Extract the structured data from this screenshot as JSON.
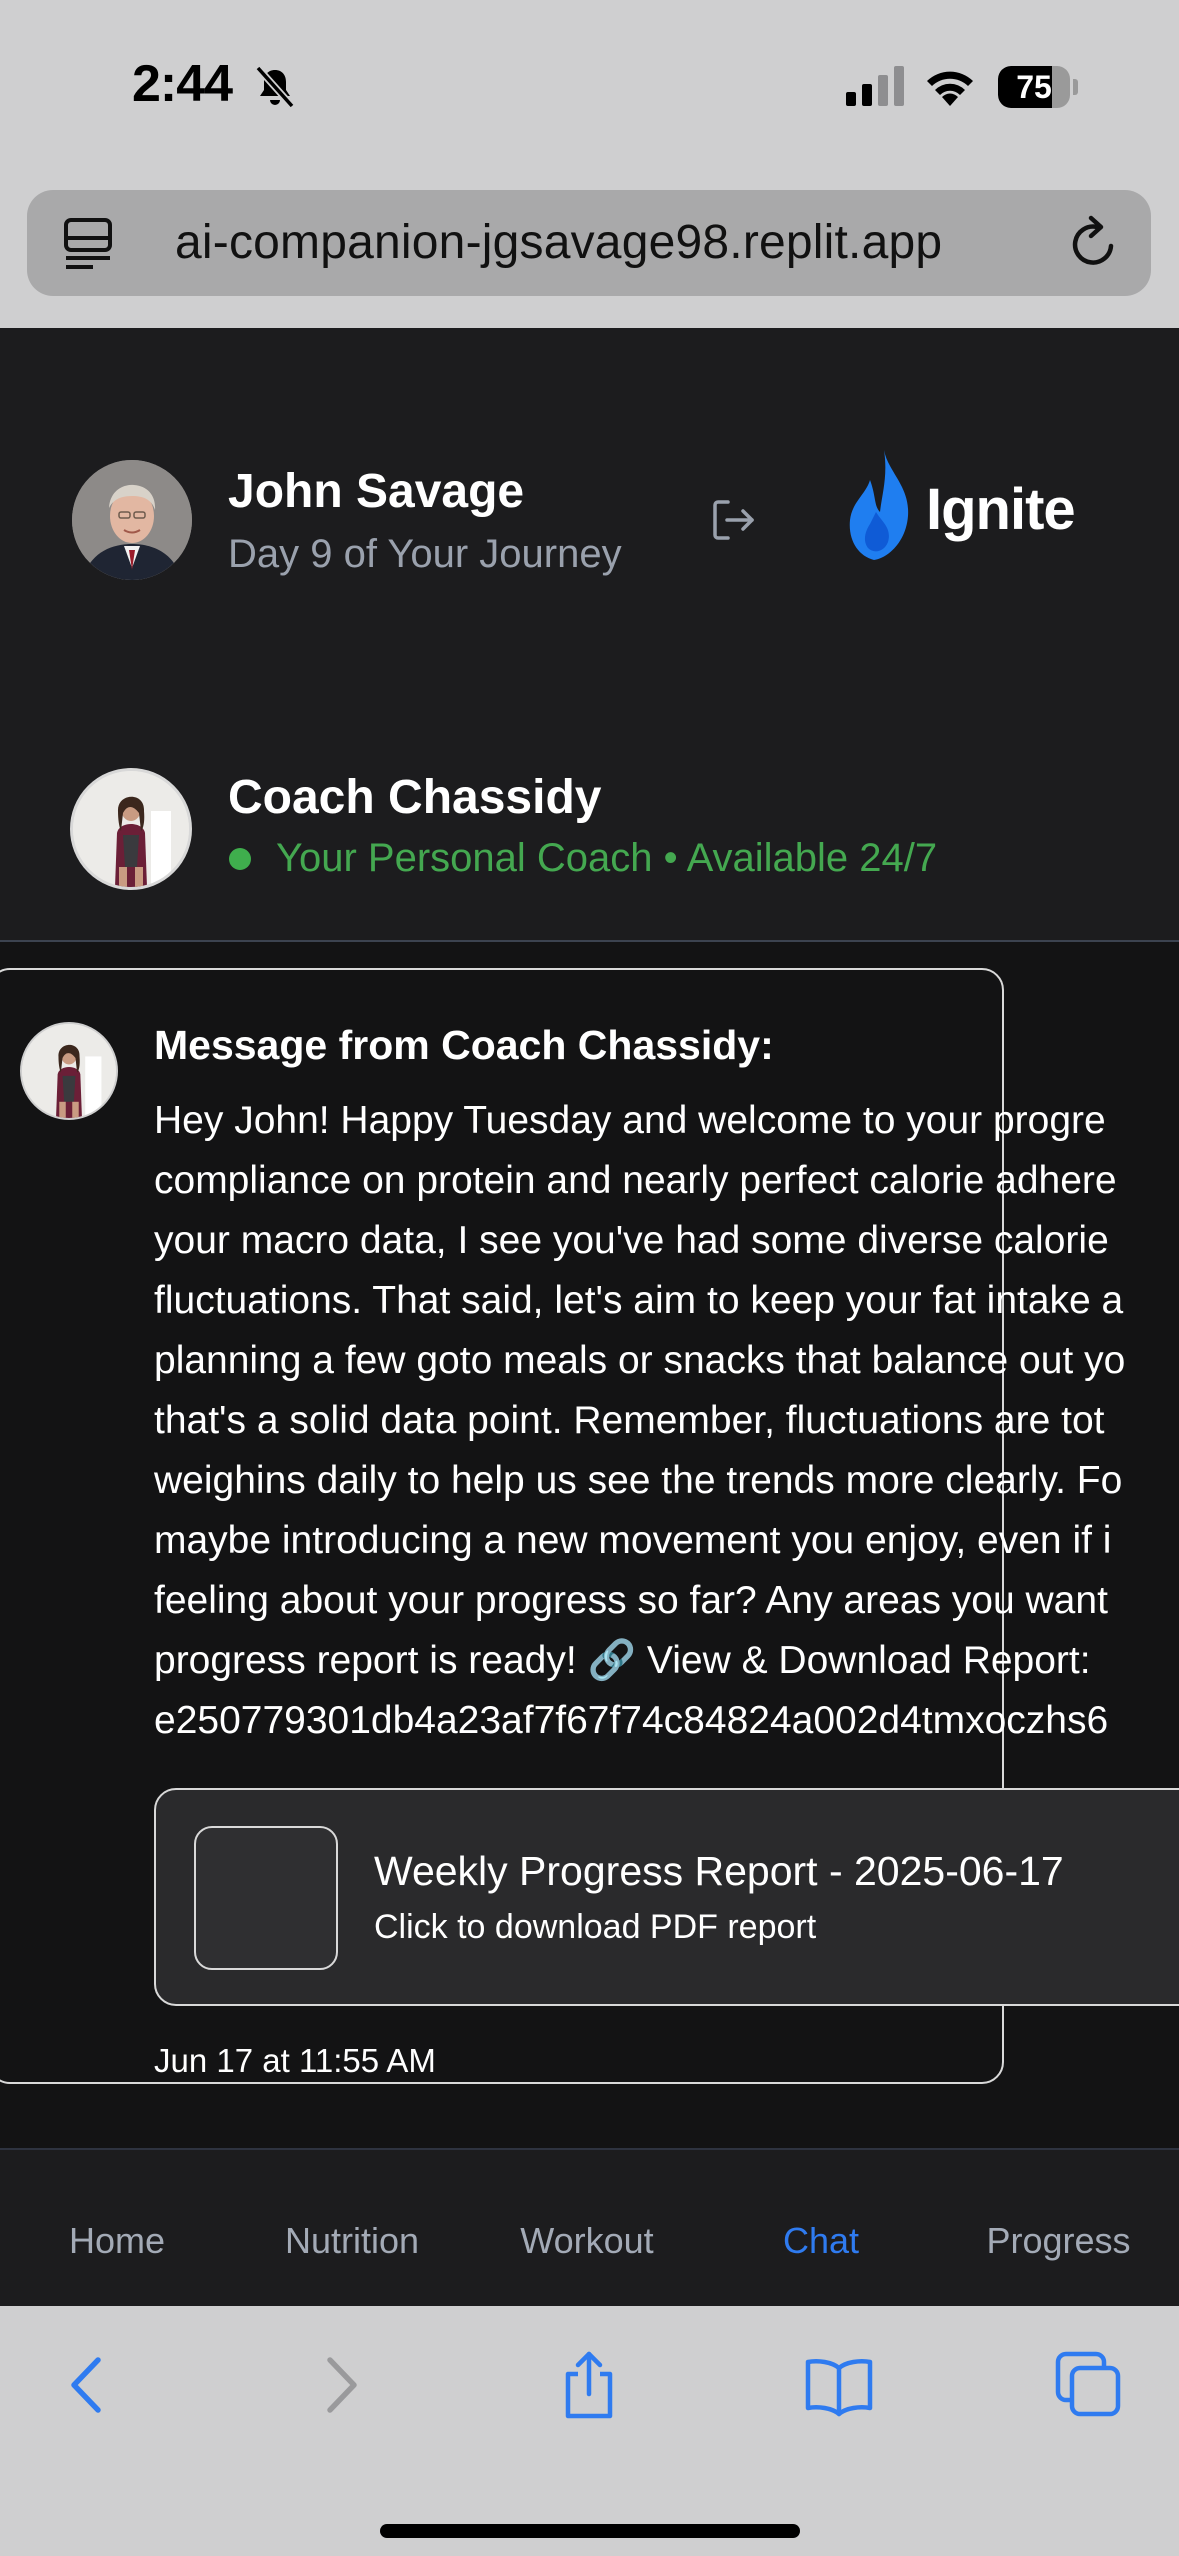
{
  "status_bar": {
    "time": "2:44",
    "battery": "75",
    "battery_fraction": 0.75
  },
  "browser": {
    "url": "ai-companion-jgsavage98.replit.app"
  },
  "header": {
    "user_name": "John Savage",
    "journey": "Day 9 of Your Journey",
    "brand": "Ignite",
    "coach_name": "Coach Chassidy",
    "coach_status": "Your Personal Coach • Available 24/7"
  },
  "message": {
    "title": "Message from Coach Chassidy:",
    "lines": [
      "Hey John! Happy Tuesday and welcome to your progre",
      "compliance on protein and nearly perfect calorie adhere",
      "your macro data, I see you've had some diverse calorie",
      "fluctuations. That said, let's aim to keep your fat intake a",
      "planning a few goto meals or snacks that balance out yo",
      "that's a solid data point. Remember, fluctuations are tot",
      "weighins daily to help us see the trends more clearly. Fo",
      "maybe introducing a new movement you enjoy, even if i",
      "feeling about your progress so far? Any areas you want",
      "progress report is ready! 🔗 View & Download Report:",
      "e250779301db4a23af7f67f74c84824a002d4tmxoczhs6"
    ],
    "attachment_title": "Weekly Progress Report - 2025-06-17",
    "attachment_sub": "Click to download PDF report",
    "timestamp": "Jun 17 at 11:55 AM"
  },
  "nav": {
    "items": [
      "Home",
      "Nutrition",
      "Workout",
      "Chat",
      "Progress"
    ],
    "active": "Chat"
  },
  "colors": {
    "accent": "#2f7bf0",
    "online": "#44a850",
    "brand_flame": "#1f7ef0"
  }
}
